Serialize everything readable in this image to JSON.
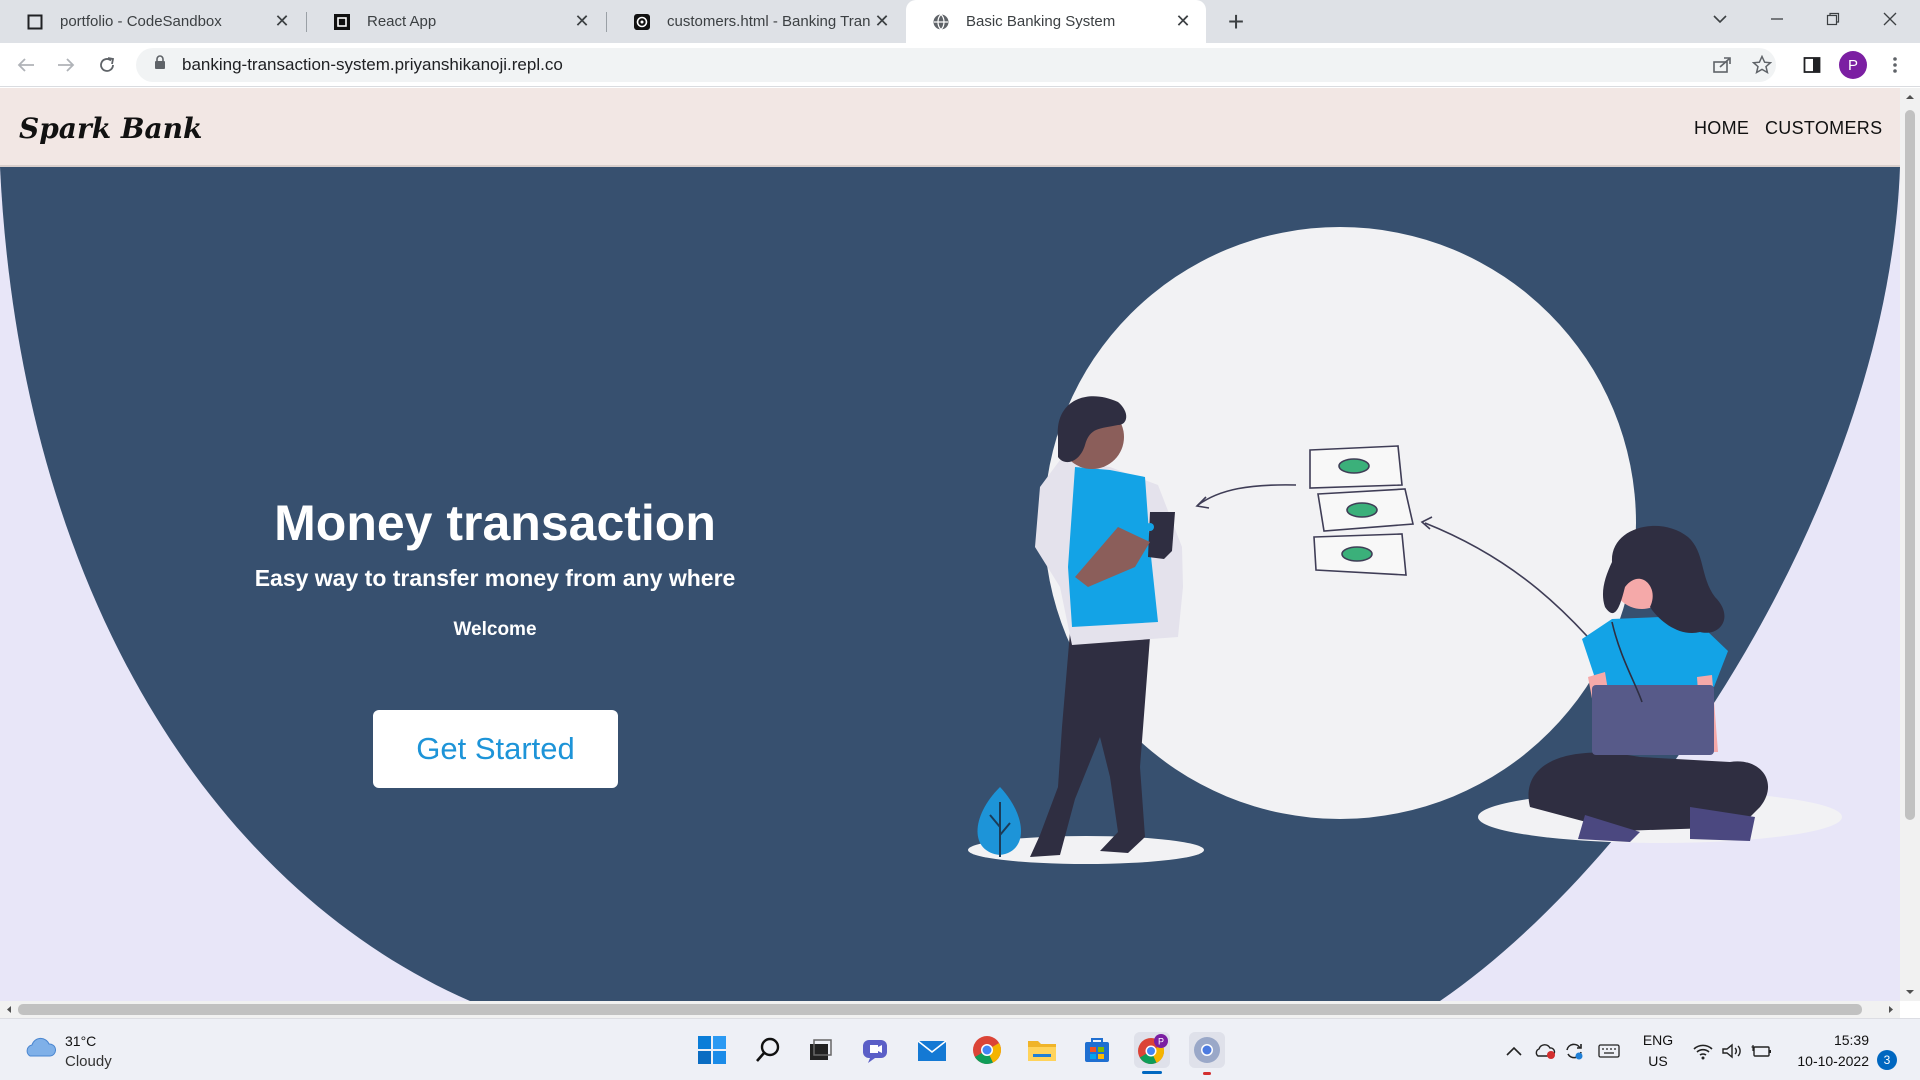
{
  "browser": {
    "tabs": [
      {
        "title": "portfolio - CodeSandbox",
        "icon": "codesandbox-icon"
      },
      {
        "title": "React App",
        "icon": "react-app-icon"
      },
      {
        "title": "customers.html - Banking Transac",
        "icon": "replit-icon"
      },
      {
        "title": "Basic Banking System",
        "icon": "globe-icon",
        "active": true
      }
    ],
    "url": "banking-transaction-system.priyanshikanoji.repl.co",
    "profile_initial": "P"
  },
  "site": {
    "logo": "Spark Bank",
    "nav": [
      "HOME",
      "CUSTOMERS"
    ],
    "hero": {
      "title": "Money transaction",
      "subtitle": "Easy way to transfer money from any where",
      "welcome": "Welcome",
      "cta": "Get Started"
    },
    "colors": {
      "hero_bg": "#37506f",
      "page_bg": "#e8e6f8",
      "nav_bg": "#f2e7e4",
      "accent": "#1d94d8"
    }
  },
  "taskbar": {
    "weather": {
      "temp": "31°C",
      "desc": "Cloudy"
    },
    "apps": [
      "start-icon",
      "search-icon",
      "task-view-icon",
      "teams-icon",
      "mail-icon",
      "chrome-icon",
      "file-explorer-icon",
      "store-icon",
      "chrome-profile-icon",
      "chrome-canary-icon"
    ],
    "lang": "ENG",
    "region": "US",
    "time": "15:39",
    "date": "10-10-2022",
    "notifications": "3"
  }
}
